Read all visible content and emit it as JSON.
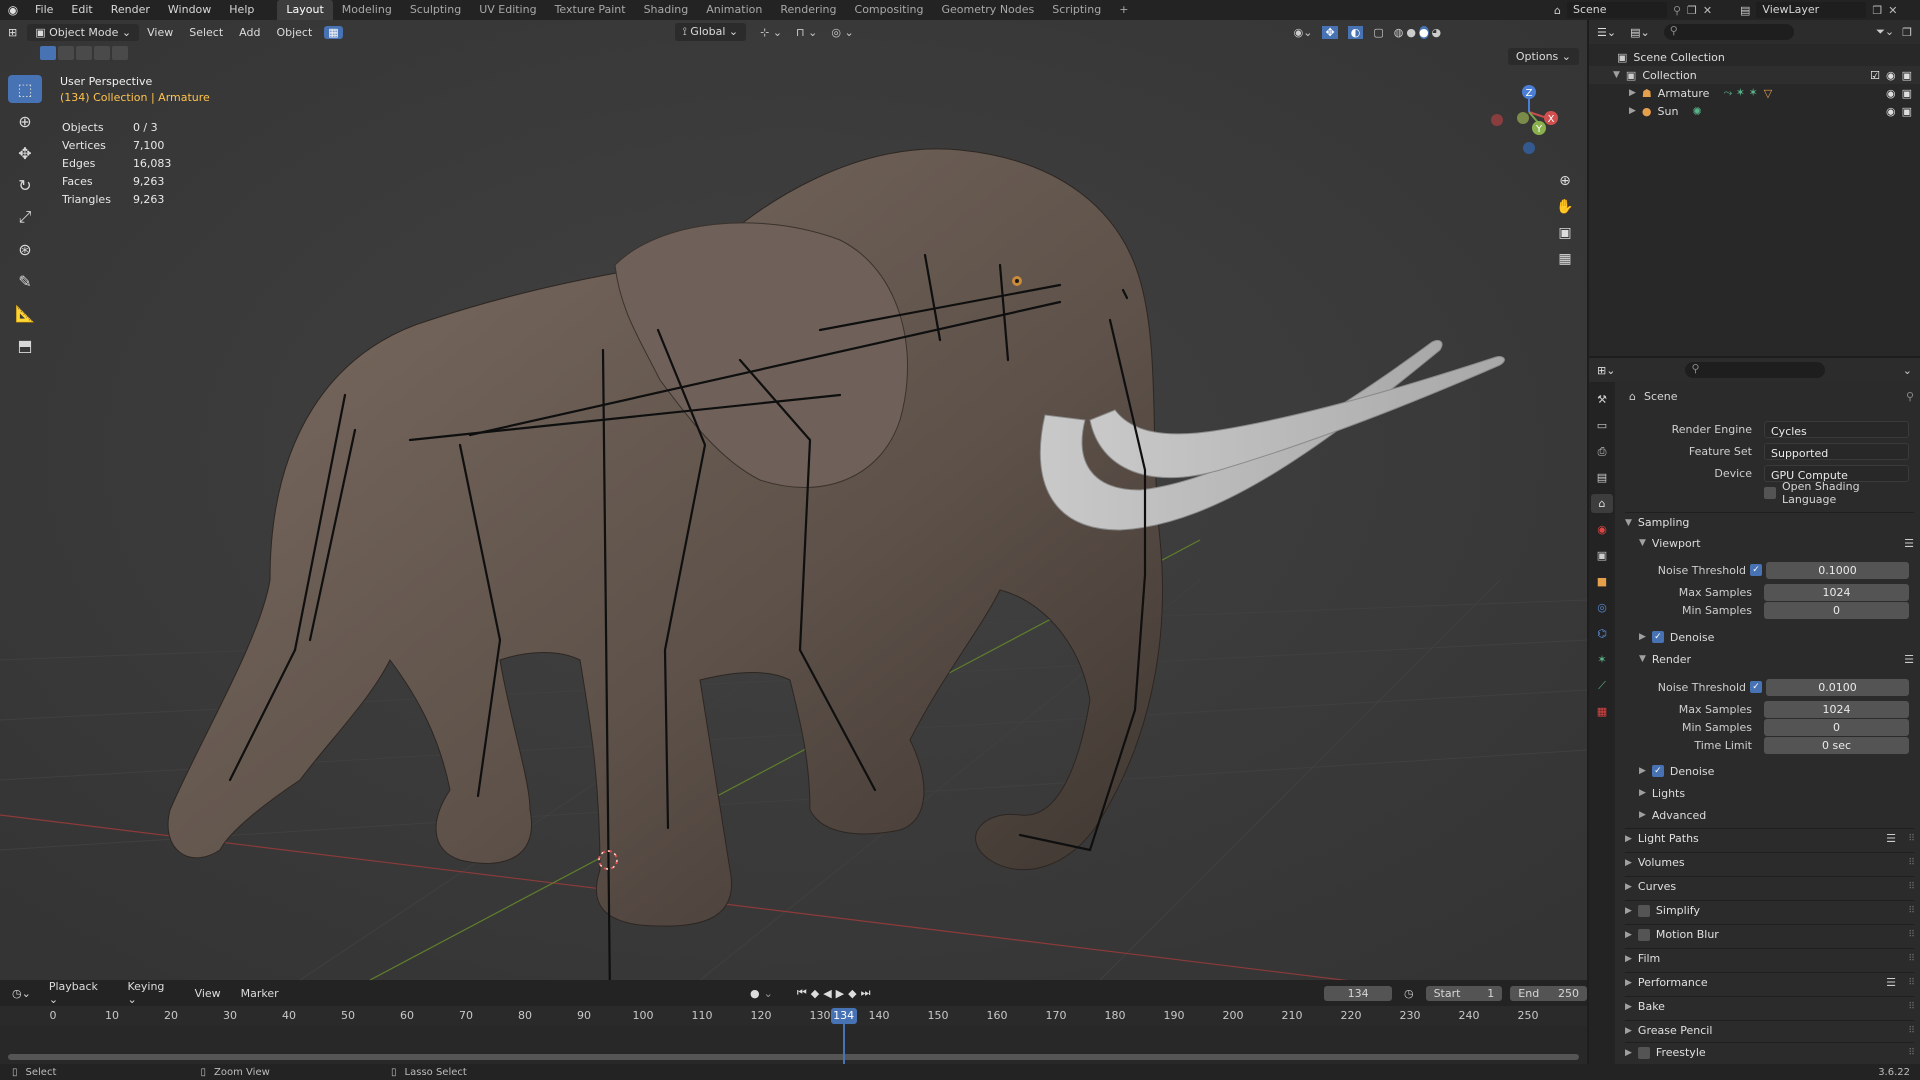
{
  "topbar": {
    "menus": [
      "File",
      "Edit",
      "Render",
      "Window",
      "Help"
    ],
    "workspaces": [
      "Layout",
      "Modeling",
      "Sculpting",
      "UV Editing",
      "Texture Paint",
      "Shading",
      "Animation",
      "Rendering",
      "Compositing",
      "Geometry Nodes",
      "Scripting"
    ],
    "active_workspace": "Layout",
    "scene_label": "Scene",
    "view_layer_label": "ViewLayer"
  },
  "viewport": {
    "mode": "Object Mode",
    "menus": [
      "View",
      "Select",
      "Add",
      "Object"
    ],
    "orientation": "Global",
    "options_label": "Options",
    "perspective": "User Perspective",
    "context": "(134) Collection | Armature",
    "stats": [
      {
        "label": "Objects",
        "value": "0 / 3"
      },
      {
        "label": "Vertices",
        "value": "7,100"
      },
      {
        "label": "Edges",
        "value": "16,083"
      },
      {
        "label": "Faces",
        "value": "9,263"
      },
      {
        "label": "Triangles",
        "value": "9,263"
      }
    ],
    "gizmo": {
      "x": "X",
      "y": "Y",
      "z": "Z"
    }
  },
  "timeline": {
    "menus": [
      "Playback",
      "Keying",
      "View",
      "Marker"
    ],
    "current_frame": "134",
    "start_label": "Start",
    "start_value": "1",
    "end_label": "End",
    "end_value": "250",
    "ticks": [
      "0",
      "10",
      "20",
      "30",
      "40",
      "50",
      "60",
      "70",
      "80",
      "90",
      "100",
      "110",
      "120",
      "130",
      "140",
      "150",
      "160",
      "170",
      "180",
      "190",
      "200",
      "210",
      "220",
      "230",
      "240",
      "250"
    ],
    "playhead": "134"
  },
  "statusbar": {
    "select": "Select",
    "zoom": "Zoom View",
    "lasso": "Lasso Select",
    "version": "3.6.22"
  },
  "outliner": {
    "root": "Scene Collection",
    "collection": "Collection",
    "items": [
      "Armature",
      "Sun"
    ]
  },
  "properties": {
    "context": "Scene",
    "render_engine_label": "Render Engine",
    "render_engine": "Cycles",
    "feature_set_label": "Feature Set",
    "feature_set": "Supported",
    "device_label": "Device",
    "device": "GPU Compute",
    "osl_label": "Open Shading Language",
    "sampling": "Sampling",
    "viewport": "Viewport",
    "noise_threshold_label": "Noise Threshold",
    "viewport_noise": "0.1000",
    "max_samples_label": "Max Samples",
    "viewport_max": "1024",
    "min_samples_label": "Min Samples",
    "viewport_min": "0",
    "denoise_label": "Denoise",
    "render": "Render",
    "render_noise": "0.0100",
    "render_max": "1024",
    "render_min": "0",
    "time_limit_label": "Time Limit",
    "time_limit": "0 sec",
    "lights": "Lights",
    "advanced": "Advanced",
    "sections": [
      "Light Paths",
      "Volumes",
      "Curves",
      "Simplify",
      "Motion Blur",
      "Film",
      "Performance",
      "Bake",
      "Grease Pencil",
      "Freestyle"
    ]
  }
}
